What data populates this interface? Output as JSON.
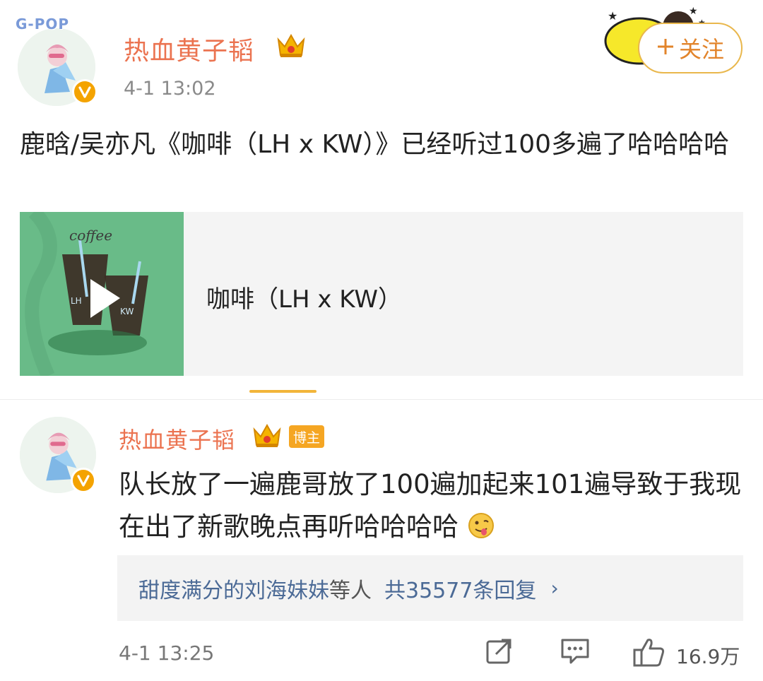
{
  "post": {
    "username": "热血黄子韬",
    "timestamp": "4-1 13:02",
    "follow_label": "关注",
    "avatar_text": "G-POP",
    "text": "鹿晗/吴亦凡《咖啡（LH x KW）》已经听过100多遍了哈哈哈哈",
    "music_card": {
      "title": "咖啡（LH x KW）",
      "cover_text": "coffee",
      "cover_labels": [
        "LH",
        "KW"
      ]
    }
  },
  "comment": {
    "username": "热血黄子韬",
    "badge": "博主",
    "text": "队长放了一遍鹿哥放了100遍加起来101遍导致于我现在出了新歌晚点再听哈哈哈哈",
    "reply_preview": {
      "names": "甜度满分的刘海妹妹",
      "mid": "等人",
      "count": "共35577条回复",
      "chevron": "›"
    },
    "timestamp": "4-1 13:25",
    "like_count": "16.9万"
  },
  "icons": {
    "follow_plus": "plus-icon",
    "share": "share-icon",
    "comment": "comment-icon",
    "like": "thumbs-up-icon",
    "crown": "crown-icon",
    "verified": "verified-v-icon"
  },
  "colors": {
    "username": "#eb7350",
    "link": "#4b6a96",
    "accent": "#f2b53a",
    "badge": "#f5a623"
  }
}
